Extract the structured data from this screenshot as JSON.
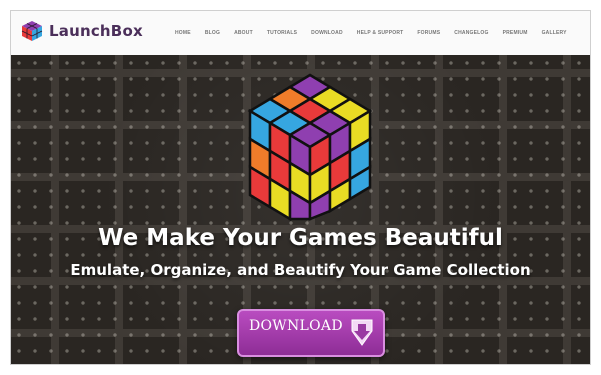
{
  "brand": {
    "name": "LaunchBox"
  },
  "nav": {
    "items": [
      "HOME",
      "BLOG",
      "ABOUT",
      "TUTORIALS",
      "DOWNLOAD",
      "HELP & SUPPORT",
      "FORUMS",
      "CHANGELOG",
      "PREMIUM",
      "GALLERY"
    ]
  },
  "hero": {
    "headline": "We Make Your Games Beautiful",
    "subheadline": "Emulate, Organize, and Beautify Your Game Collection",
    "download": {
      "label": "DOWNLOAD",
      "sub_line1": "",
      "sub_line2": ""
    }
  },
  "colors": {
    "accent": "#a43fae",
    "cube": [
      "#8f3fb0",
      "#e9dc24",
      "#36a6e0",
      "#e93a3a",
      "#f07c2a",
      "#e9dc24",
      "#36a6e0",
      "#8f3fb0",
      "#f07c2a"
    ]
  },
  "icons": {
    "logo": "rubik-cube-icon",
    "download": "download-arrow-icon"
  }
}
